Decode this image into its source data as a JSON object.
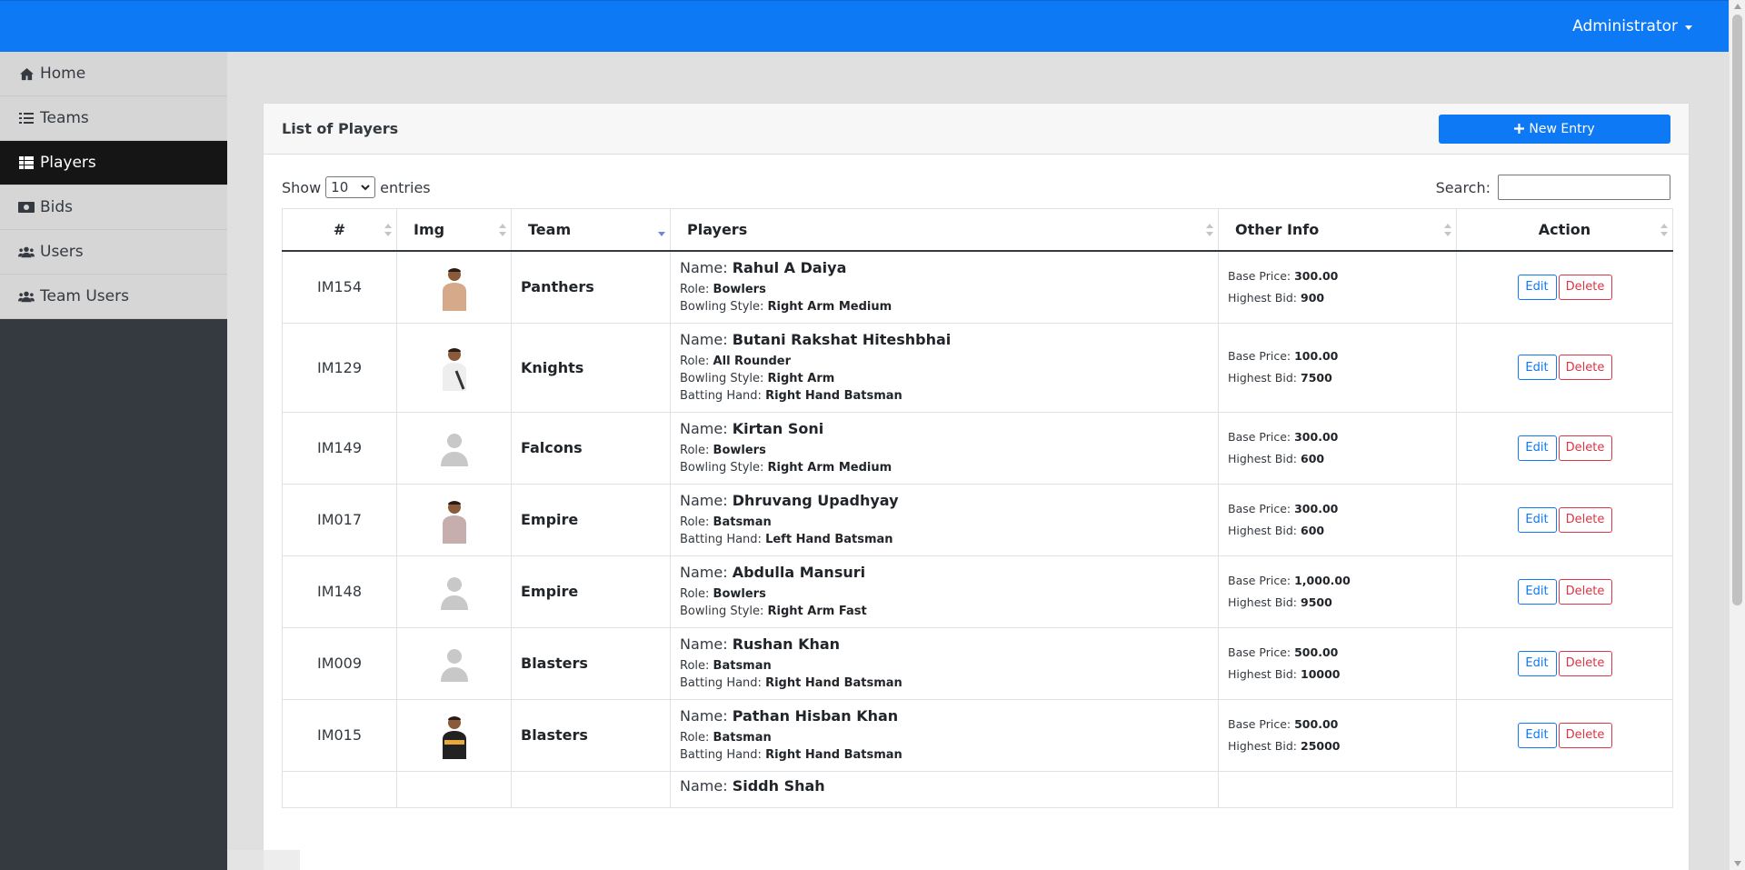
{
  "header": {
    "user_menu_label": "Administrator",
    "accent_color": "#0d79f5"
  },
  "sidebar": {
    "items": [
      {
        "label": "Home",
        "icon": "home-icon"
      },
      {
        "label": "Teams",
        "icon": "list-icon"
      },
      {
        "label": "Players",
        "icon": "table-icon",
        "active": true
      },
      {
        "label": "Bids",
        "icon": "money-icon"
      },
      {
        "label": "Users",
        "icon": "users-icon"
      },
      {
        "label": "Team Users",
        "icon": "users-icon"
      }
    ]
  },
  "card": {
    "title": "List of Players",
    "new_entry_label": "New Entry"
  },
  "controls": {
    "show_label": "Show",
    "page_size": "10",
    "entries_label": "entries",
    "search_label": "Search:",
    "search_value": ""
  },
  "table": {
    "columns": [
      "#",
      "Img",
      "Team",
      "Players",
      "Other Info",
      "Action"
    ],
    "sorted_column": "Team",
    "rows": [
      {
        "id": "IM154",
        "img": "photo-beige",
        "team": "Panthers",
        "name": "Rahul A Daiya",
        "role": "Bowlers",
        "lines": [
          {
            "k": "Bowling Style:",
            "v": "Right Arm Medium"
          }
        ],
        "base_price": "300.00",
        "highest_bid": "900"
      },
      {
        "id": "IM129",
        "img": "photo-white",
        "team": "Knights",
        "name": "Butani Rakshat Hiteshbhai",
        "role": "All Rounder",
        "lines": [
          {
            "k": "Bowling Style:",
            "v": "Right Arm"
          },
          {
            "k": "Batting Hand:",
            "v": "Right Hand Batsman"
          }
        ],
        "base_price": "100.00",
        "highest_bid": "7500"
      },
      {
        "id": "IM149",
        "img": "placeholder",
        "team": "Falcons",
        "name": "Kirtan Soni",
        "role": "Bowlers",
        "lines": [
          {
            "k": "Bowling Style:",
            "v": "Right Arm Medium"
          }
        ],
        "base_price": "300.00",
        "highest_bid": "600"
      },
      {
        "id": "IM017",
        "img": "photo-grey",
        "team": "Empire",
        "name": "Dhruvang Upadhyay",
        "role": "Batsman",
        "lines": [
          {
            "k": "Batting Hand:",
            "v": "Left Hand Batsman"
          }
        ],
        "base_price": "300.00",
        "highest_bid": "600"
      },
      {
        "id": "IM148",
        "img": "placeholder",
        "team": "Empire",
        "name": "Abdulla Mansuri",
        "role": "Bowlers",
        "lines": [
          {
            "k": "Bowling Style:",
            "v": "Right Arm Fast"
          }
        ],
        "base_price": "1,000.00",
        "highest_bid": "9500"
      },
      {
        "id": "IM009",
        "img": "placeholder",
        "team": "Blasters",
        "name": "Rushan Khan",
        "role": "Batsman",
        "lines": [
          {
            "k": "Batting Hand:",
            "v": "Right Hand Batsman"
          }
        ],
        "base_price": "500.00",
        "highest_bid": "10000"
      },
      {
        "id": "IM015",
        "img": "photo-black",
        "team": "Blasters",
        "name": "Pathan Hisban Khan",
        "role": "Batsman",
        "lines": [
          {
            "k": "Batting Hand:",
            "v": "Right Hand Batsman"
          }
        ],
        "base_price": "500.00",
        "highest_bid": "25000"
      },
      {
        "id": "",
        "img": "",
        "team": "",
        "name": "Siddh Shah",
        "role": "",
        "lines": [],
        "base_price": "",
        "highest_bid": ""
      }
    ],
    "labels": {
      "name": "Name:",
      "role": "Role:",
      "base_price": "Base Price:",
      "highest_bid": "Highest Bid:",
      "edit": "Edit",
      "delete": "Delete"
    }
  }
}
